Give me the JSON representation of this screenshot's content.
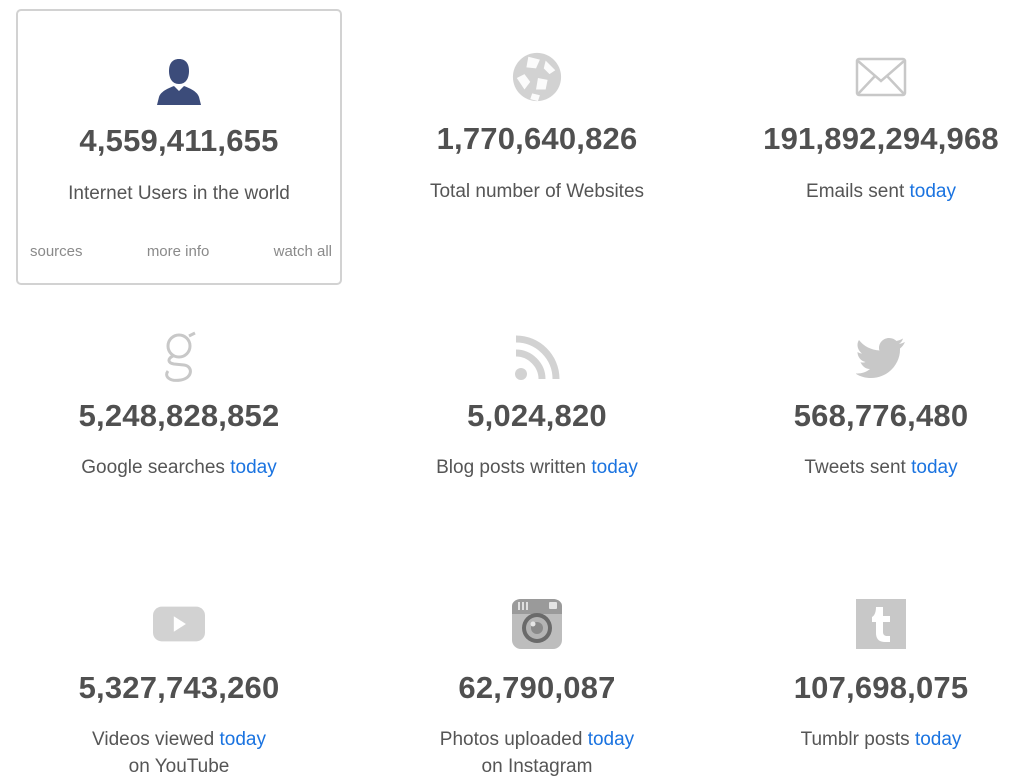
{
  "items": [
    {
      "count": "4,559,411,655",
      "label": "Internet Users in the world",
      "links": {
        "sources": "sources",
        "more_info": "more info",
        "watch_all": "watch all"
      },
      "icon": "user-icon"
    },
    {
      "count": "1,770,640,826",
      "label": "Total number of Websites",
      "icon": "globe-icon"
    },
    {
      "count": "191,892,294,968",
      "label": "Emails sent",
      "today": "today",
      "icon": "email-icon"
    },
    {
      "count": "5,248,828,852",
      "label": "Google searches",
      "today": "today",
      "icon": "google-icon"
    },
    {
      "count": "5,024,820",
      "label": "Blog posts written",
      "today": "today",
      "icon": "rss-icon"
    },
    {
      "count": "568,776,480",
      "label": "Tweets sent",
      "today": "today",
      "icon": "twitter-icon"
    },
    {
      "count": "5,327,743,260",
      "label": "Videos viewed",
      "today": "today",
      "label2": "on YouTube",
      "icon": "youtube-icon"
    },
    {
      "count": "62,790,087",
      "label": "Photos uploaded",
      "today": "today",
      "label2": "on Instagram",
      "icon": "instagram-icon"
    },
    {
      "count": "107,698,075",
      "label": "Tumblr posts",
      "today": "today",
      "icon": "tumblr-icon"
    }
  ],
  "colors": {
    "link_blue": "#1a73e0",
    "counter_gray": "#505050",
    "icon_gray": "#c8c8c8",
    "user_icon_blue": "#3c4c7a"
  }
}
